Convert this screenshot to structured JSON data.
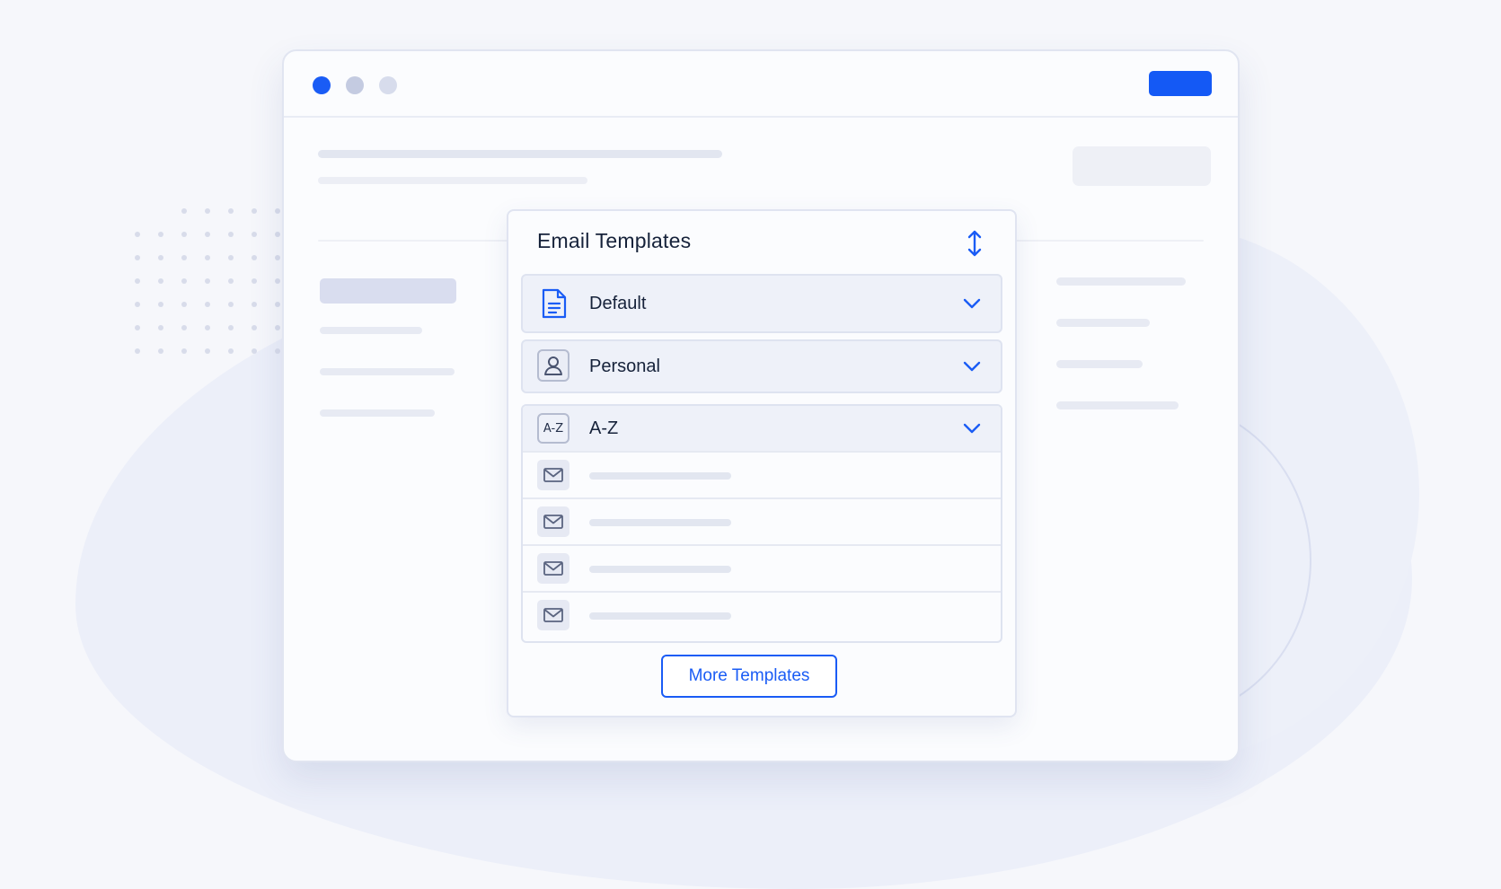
{
  "window": {
    "traffic_lights": [
      "close",
      "minimize",
      "zoom"
    ]
  },
  "email_templates": {
    "title": "Email Templates",
    "sort_icon": "sort-vertical-icon",
    "categories": [
      {
        "label": "Default",
        "icon": "document-icon",
        "expanded": false
      },
      {
        "label": "Personal",
        "icon": "person-icon",
        "expanded": false
      },
      {
        "label": "A-Z",
        "icon_text": "A-Z",
        "expanded": true,
        "items": [
          {
            "icon": "mail-icon"
          },
          {
            "icon": "mail-icon"
          },
          {
            "icon": "mail-icon"
          },
          {
            "icon": "mail-icon"
          }
        ]
      }
    ],
    "more_button": "More Templates"
  },
  "colors": {
    "accent": "#1a5cf5",
    "text": "#16223a",
    "row_background": "#eef1f9",
    "border": "#dee3f0",
    "placeholder": "#e7eaf3",
    "page_background": "#f6f7fb"
  }
}
